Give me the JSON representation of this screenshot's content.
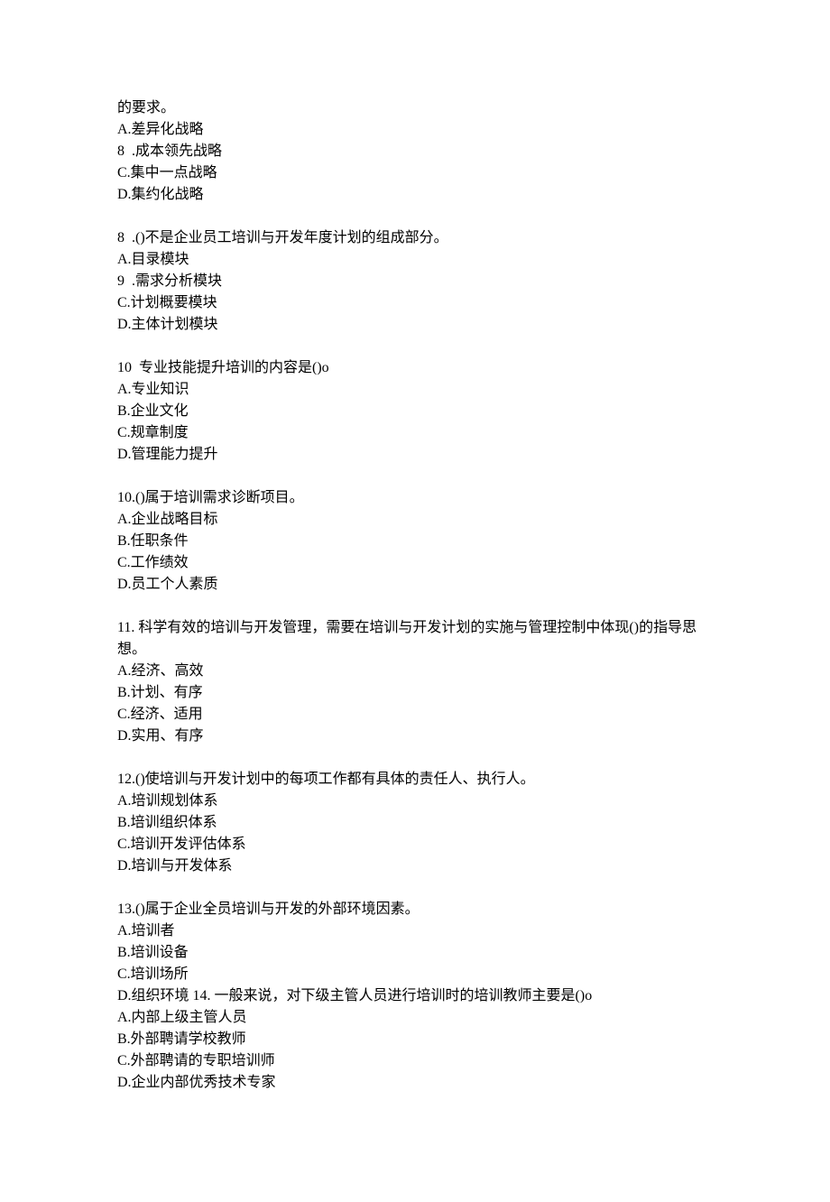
{
  "blocks": [
    {
      "id": "q7",
      "lines": [
        "的要求。",
        "A.差异化战略",
        "8  .成本领先战略",
        "C.集中一点战略",
        "D.集约化战略"
      ]
    },
    {
      "id": "q8",
      "lines": [
        "8  .()不是企业员工培训与开发年度计划的组成部分。",
        "A.目录模块",
        "9  .需求分析模块",
        "C.计划概要模块",
        "D.主体计划模块"
      ]
    },
    {
      "id": "q9",
      "lines": [
        "10  专业技能提升培训的内容是()o",
        "A.专业知识",
        "B.企业文化",
        "C.规章制度",
        "D.管理能力提升"
      ]
    },
    {
      "id": "q10",
      "lines": [
        "10.()属于培训需求诊断项目。",
        "A.企业战略目标",
        "B.任职条件",
        "C.工作绩效",
        "D.员工个人素质"
      ]
    },
    {
      "id": "q11",
      "lines": [
        "11. 科学有效的培训与开发管理，需要在培训与开发计划的实施与管理控制中体现()的指导思想。",
        "A.经济、高效",
        "B.计划、有序",
        "C.经济、适用",
        "D.实用、有序"
      ]
    },
    {
      "id": "q12",
      "lines": [
        "12.()使培训与开发计划中的每项工作都有具体的责任人、执行人。",
        "A.培训规划体系",
        "B.培训组织体系",
        "C.培训开发评估体系",
        "D.培训与开发体系"
      ]
    },
    {
      "id": "q13",
      "lines": [
        "13.()属于企业全员培训与开发的外部环境因素。",
        "A.培训者",
        "B.培训设备",
        "C.培训场所",
        "D.组织环境 14. 一般来说，对下级主管人员进行培训时的培训教师主要是()o",
        "A.内部上级主管人员",
        "B.外部聘请学校教师",
        "C.外部聘请的专职培训师",
        "D.企业内部优秀技术专家"
      ]
    }
  ]
}
